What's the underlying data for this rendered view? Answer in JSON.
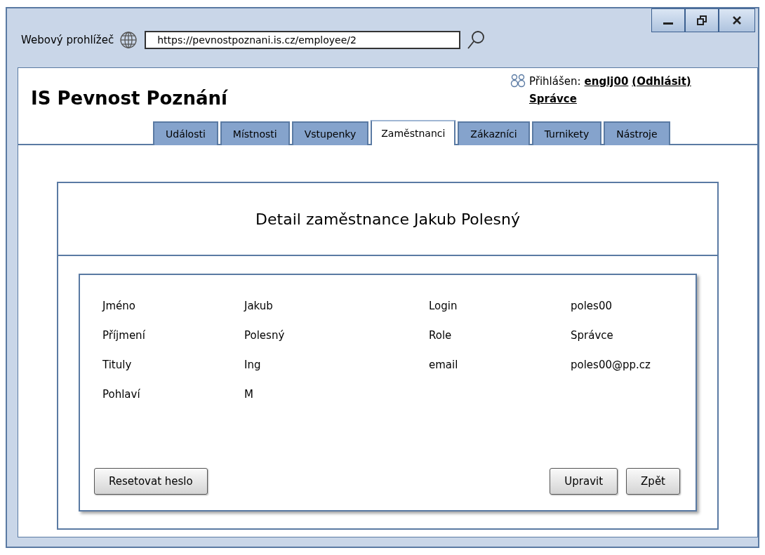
{
  "window": {
    "title": "Webový prohlížeč",
    "address": "https://pevnostpoznani.is.cz/employee/2"
  },
  "app": {
    "title": "IS Pevnost Poznání",
    "login_label": "Přihlášen:",
    "user": "englj00",
    "logout": "(Odhlásit)",
    "role": "Správce"
  },
  "tabs": [
    {
      "label": "Události",
      "selected": false
    },
    {
      "label": "Místnosti",
      "selected": false
    },
    {
      "label": "Vstupenky",
      "selected": false
    },
    {
      "label": "Zaměstnanci",
      "selected": true
    },
    {
      "label": "Zákazníci",
      "selected": false
    },
    {
      "label": "Turnikety",
      "selected": false
    },
    {
      "label": "Nástroje",
      "selected": false
    }
  ],
  "detail": {
    "title": "Detail zaměstnance Jakub Polesný",
    "left_fields": [
      {
        "label": "Jméno",
        "value": "Jakub"
      },
      {
        "label": "Příjmení",
        "value": "Polesný"
      },
      {
        "label": "Tituly",
        "value": "Ing"
      },
      {
        "label": "Pohlaví",
        "value": "M"
      }
    ],
    "right_fields": [
      {
        "label": "Login",
        "value": "poles00"
      },
      {
        "label": "Role",
        "value": "Správce"
      },
      {
        "label": "email",
        "value": "poles00@pp.cz"
      }
    ],
    "left_buttons": [
      "Resetovat heslo"
    ],
    "right_buttons": [
      "Upravit",
      "Zpět"
    ]
  }
}
